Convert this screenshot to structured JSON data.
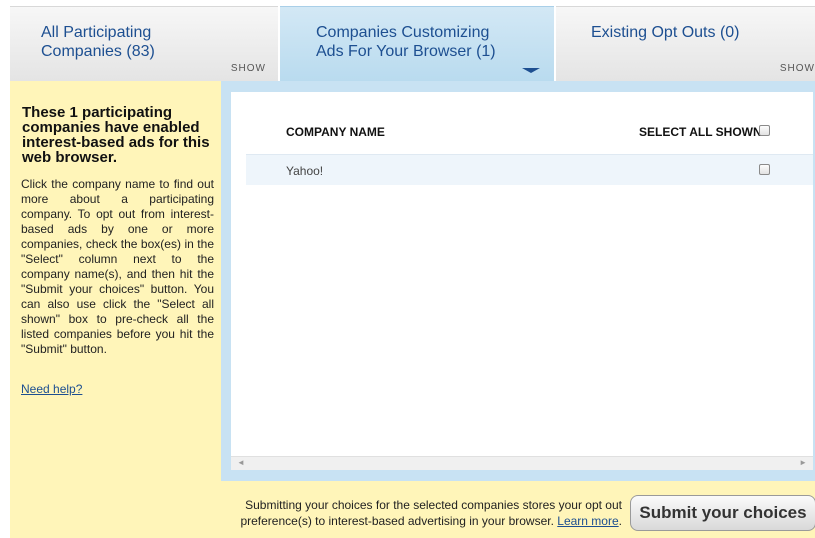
{
  "tabs": [
    {
      "title_line1": "All Participating",
      "title_line2": "Companies (83)",
      "show": "SHOW"
    },
    {
      "title_line1": "Companies Customizing",
      "title_line2": "Ads For Your Browser (1)"
    },
    {
      "title": "Existing Opt Outs (0)",
      "show": "SHOW"
    }
  ],
  "sidebar": {
    "heading": "These 1 participating companies have enabled interest-based ads for this web browser.",
    "description": "Click the company name to find out more about a participating company. To opt out from interest-based ads by one or more companies, check the box(es) in the \"Select\" column next to the company name(s), and then hit the \"Submit your choices\" button. You can also use click the \"Select all shown\" box to pre-check all the listed companies before you hit the \"Submit\" button.",
    "help_link": "Need help?"
  },
  "table": {
    "column_name": "COMPANY NAME",
    "select_all": "SELECT ALL SHOWN",
    "rows": [
      {
        "name": "Yahoo!",
        "checked": false
      }
    ]
  },
  "scroll": {
    "left": "◄",
    "right": "►"
  },
  "footer": {
    "note_line1": "Submitting your choices for the selected companies stores your opt out",
    "note_line2": "preference(s) to interest-based advertising in your browser.",
    "learn_more": "Learn more",
    "note_end": ".",
    "submit_label": "Submit your choices"
  }
}
